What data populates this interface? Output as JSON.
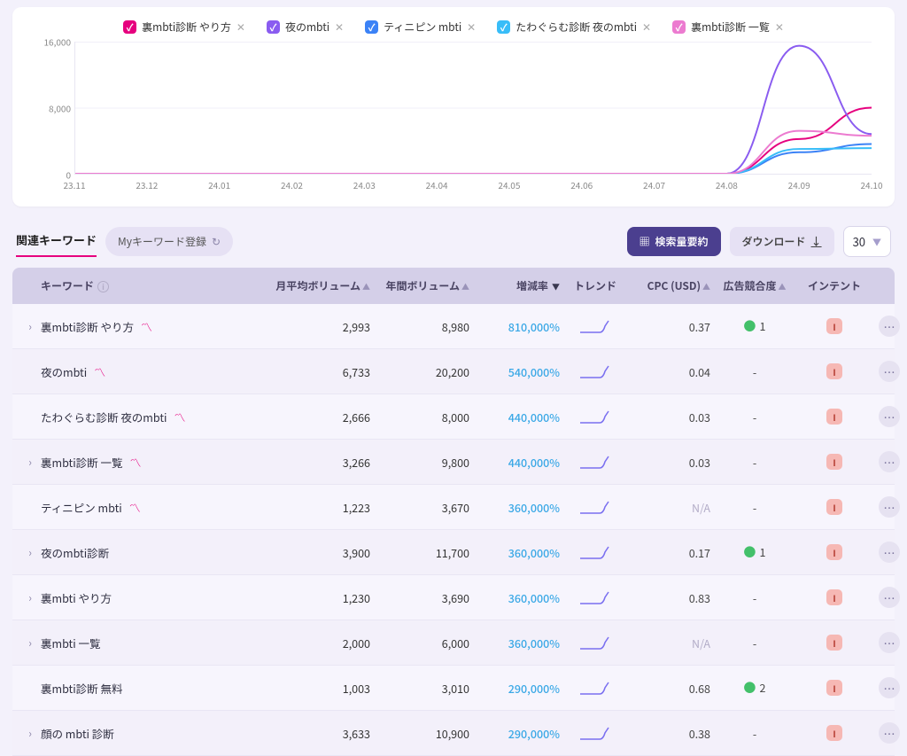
{
  "chart_data": {
    "type": "line",
    "xlabels": [
      "23.11",
      "23.12",
      "24.01",
      "24.02",
      "24.03",
      "24.04",
      "24.05",
      "24.06",
      "24.07",
      "24.08",
      "24.09",
      "24.10"
    ],
    "ylim": [
      0,
      16000
    ],
    "yticks": [
      0,
      8000,
      16000
    ],
    "ylabels": [
      "0",
      "8,000",
      "16,000"
    ],
    "series": [
      {
        "name": "裏mbti診断 やり方",
        "color": "#e6007e",
        "values": [
          0,
          0,
          0,
          0,
          0,
          0,
          0,
          0,
          0,
          0,
          4200,
          8000
        ]
      },
      {
        "name": "夜のmbti",
        "color": "#8a5cf0",
        "values": [
          0,
          0,
          0,
          0,
          0,
          0,
          0,
          0,
          0,
          0,
          15500,
          4800
        ]
      },
      {
        "name": "ティニピン mbti",
        "color": "#3b82f6",
        "values": [
          0,
          0,
          0,
          0,
          0,
          0,
          0,
          0,
          0,
          0,
          2600,
          3600
        ]
      },
      {
        "name": "たわぐらむ診断 夜のmbti",
        "color": "#38bdf8",
        "values": [
          0,
          0,
          0,
          0,
          0,
          0,
          0,
          0,
          0,
          0,
          3000,
          3100
        ]
      },
      {
        "name": "裏mbti診断 一覧",
        "color": "#ec7bd0",
        "values": [
          0,
          0,
          0,
          0,
          0,
          0,
          0,
          0,
          0,
          0,
          5200,
          4600
        ]
      }
    ]
  },
  "toolbar": {
    "tab": "関連キーワード",
    "mykw": "Myキーワード登録",
    "search": "検索量要約",
    "download": "ダウンロード",
    "rows": "30"
  },
  "cols": {
    "kw": "キーワード",
    "mv": "月平均ボリューム",
    "yv": "年間ボリューム",
    "chg": "増減率",
    "trend": "トレンド",
    "cpc": "CPC (USD)",
    "comp": "広告競合度",
    "intent": "インテント"
  },
  "rows": [
    {
      "exp": true,
      "kw": "裏mbti診断 やり方",
      "hasChart": true,
      "mv": "2,993",
      "yv": "8,980",
      "chg": "810,000%",
      "cpc": "0.37",
      "comp": "1",
      "intent": "I"
    },
    {
      "exp": false,
      "kw": "夜のmbti",
      "hasChart": true,
      "mv": "6,733",
      "yv": "20,200",
      "chg": "540,000%",
      "cpc": "0.04",
      "comp": "-",
      "intent": "I"
    },
    {
      "exp": false,
      "kw": "たわぐらむ診断 夜のmbti",
      "hasChart": true,
      "mv": "2,666",
      "yv": "8,000",
      "chg": "440,000%",
      "cpc": "0.03",
      "comp": "-",
      "intent": "I"
    },
    {
      "exp": true,
      "kw": "裏mbti診断 一覧",
      "hasChart": true,
      "mv": "3,266",
      "yv": "9,800",
      "chg": "440,000%",
      "cpc": "0.03",
      "comp": "-",
      "intent": "I"
    },
    {
      "exp": false,
      "kw": "ティニピン mbti",
      "hasChart": true,
      "mv": "1,223",
      "yv": "3,670",
      "chg": "360,000%",
      "cpc": "N/A",
      "comp": "-",
      "intent": "I"
    },
    {
      "exp": true,
      "kw": "夜のmbti診断",
      "hasChart": false,
      "mv": "3,900",
      "yv": "11,700",
      "chg": "360,000%",
      "cpc": "0.17",
      "comp": "1",
      "intent": "I"
    },
    {
      "exp": true,
      "kw": "裏mbti やり方",
      "hasChart": false,
      "mv": "1,230",
      "yv": "3,690",
      "chg": "360,000%",
      "cpc": "0.83",
      "comp": "-",
      "intent": "I"
    },
    {
      "exp": true,
      "kw": "裏mbti 一覧",
      "hasChart": false,
      "mv": "2,000",
      "yv": "6,000",
      "chg": "360,000%",
      "cpc": "N/A",
      "comp": "-",
      "intent": "I"
    },
    {
      "exp": false,
      "kw": "裏mbti診断 無料",
      "hasChart": false,
      "mv": "1,003",
      "yv": "3,010",
      "chg": "290,000%",
      "cpc": "0.68",
      "comp": "2",
      "intent": "I"
    },
    {
      "exp": true,
      "kw": "顔の mbti 診断",
      "hasChart": false,
      "mv": "3,633",
      "yv": "10,900",
      "chg": "290,000%",
      "cpc": "0.38",
      "comp": "-",
      "intent": "I"
    }
  ]
}
